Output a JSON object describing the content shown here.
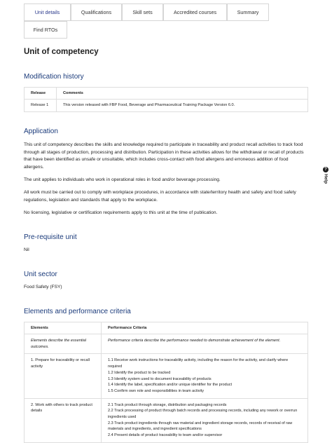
{
  "tabs": [
    {
      "label": "Unit details"
    },
    {
      "label": "Qualifications"
    },
    {
      "label": "Skill sets"
    },
    {
      "label": "Accredited courses"
    },
    {
      "label": "Summary"
    },
    {
      "label": "Find RTOs"
    }
  ],
  "page_title": "Unit of competency",
  "modification_history": {
    "heading": "Modification history",
    "columns": [
      "Release",
      "Comments"
    ],
    "rows": [
      {
        "release": "Release 1",
        "comments": "This version released with FBP Food, Beverage and Pharmaceutical Training Package Version 6.0."
      }
    ]
  },
  "application": {
    "heading": "Application",
    "paragraphs": [
      "This unit of competency describes the skills and knowledge required to participate in traceability and product recall activities to track food through all stages of production, processing and distribution. Participation in these activities allows for the withdrawal or recall of products that have been identified as unsafe or unsuitable, which includes cross-contact with food allergens and erroneous addition of food allergens.",
      "The unit applies to individuals who work in operational roles in food and/or beverage processing.",
      "All work must be carried out to comply with workplace procedures, in accordance with state/territory health and safety and food safety regulations, legislation and standards that apply to the workplace.",
      "No licensing, legislative or certification requirements apply to this unit at the time of publication."
    ]
  },
  "prerequisite": {
    "heading": "Pre-requisite unit",
    "value": "Nil"
  },
  "unit_sector": {
    "heading": "Unit sector",
    "value": "Food Safety (FSY)"
  },
  "elements": {
    "heading": "Elements and performance criteria",
    "columns": [
      "Elements",
      "Performance Criteria"
    ],
    "intro": {
      "element": "Elements describe the essential outcomes.",
      "criteria": "Performance criteria describe the performance needed to demonstrate achievement of the element."
    },
    "rows": [
      {
        "element": "1. Prepare for traceability or recall activity",
        "criteria": [
          "1.1 Receive work instructions for traceability activity, including the reason for the activity, and clarify where required",
          "1.2 Identify the product to be tracked",
          "1.3 Identify system used to document traceability of products",
          "1.4 Identify the label, specification and/or unique identifier for the product",
          "1.5 Confirm own role and responsibilities in team activity"
        ]
      },
      {
        "element": "2. Work with others to track product details",
        "criteria": [
          "2.1 Track product through storage, distribution and packaging records",
          "2.2 Track processing of product through batch records and processing records, including any rework or overrun ingredients used",
          "2.3 Track product ingredients through raw material and ingredient storage records, records of receival of raw materials and ingredients, and ingredient specifications",
          "2.4 Present details of product traceability to team and/or supervisor"
        ]
      }
    ]
  },
  "help": {
    "label": "Help",
    "icon": "question-icon"
  },
  "colors": {
    "heading": "#1a3a7a",
    "active_tab": "#2b3a8c",
    "border": "#d6d6d6"
  }
}
